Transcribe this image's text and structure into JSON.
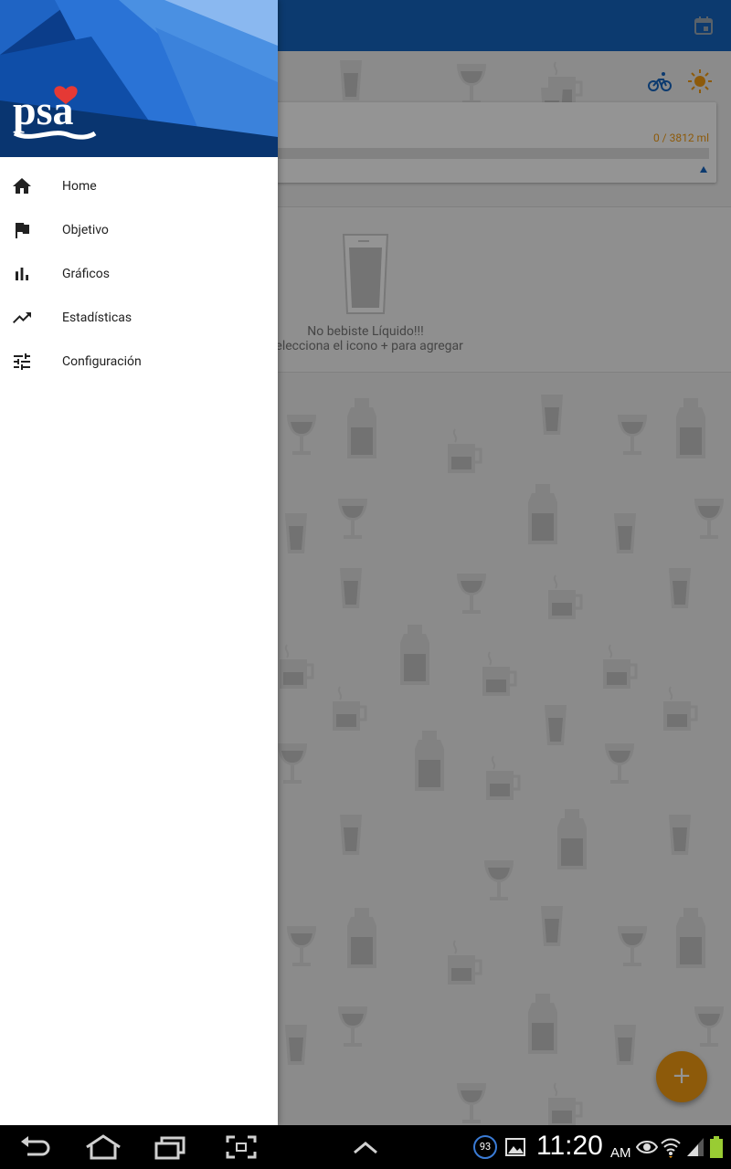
{
  "app": {
    "progress_text": "0 / 3812 ml",
    "empty_title": "No bebiste Líquido!!!",
    "empty_hint": "Selecciona el icono + para agregar",
    "fab_label": "+",
    "colors": {
      "primary": "#1565c0",
      "accent": "#f39c12"
    },
    "icons": {
      "calendar": "calendar-icon",
      "activity": "bike-icon",
      "weather": "sun-icon"
    }
  },
  "drawer": {
    "logo_text": "psa",
    "items": [
      {
        "label": "Home",
        "icon": "home-icon"
      },
      {
        "label": "Objetivo",
        "icon": "flag-icon"
      },
      {
        "label": "Gráficos",
        "icon": "bar-chart-icon"
      },
      {
        "label": "Estadísticas",
        "icon": "trending-up-icon"
      },
      {
        "label": "Configuración",
        "icon": "sliders-icon"
      }
    ]
  },
  "system_bar": {
    "notification_count": "93",
    "time": "11:20",
    "ampm": "AM"
  }
}
